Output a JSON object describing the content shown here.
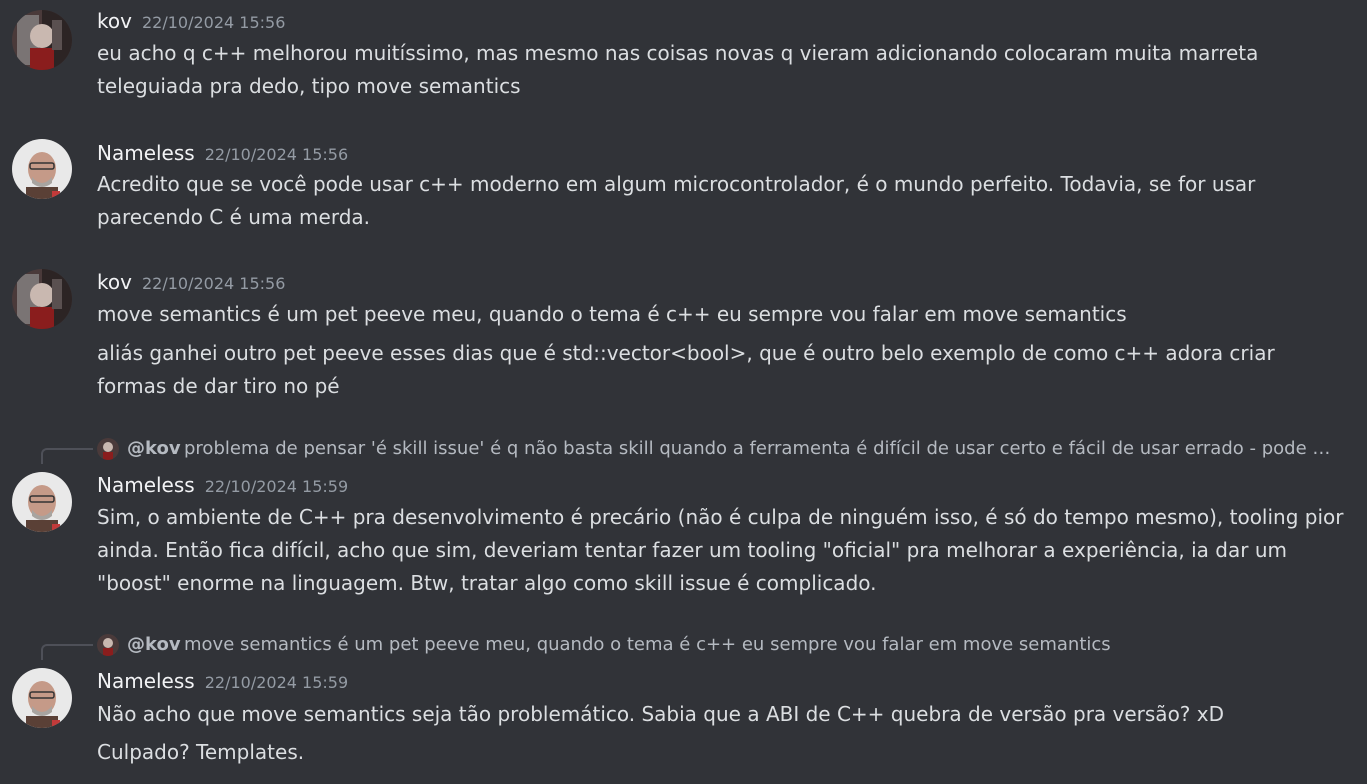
{
  "messages": [
    {
      "author": "kov",
      "timestamp": "22/10/2024 15:56",
      "lines": [
        "eu acho q c++ melhorou muitíssimo, mas mesmo nas coisas novas q vieram adicionando colocaram muita marreta",
        "teleguiada pra dedo, tipo move semantics"
      ]
    },
    {
      "author": "Nameless",
      "timestamp": "22/10/2024 15:56",
      "lines": [
        "Acredito que se você pode usar c++ moderno em algum microcontrolador, é o mundo perfeito. Todavia, se for usar",
        "parecendo C é uma merda."
      ]
    },
    {
      "author": "kov",
      "timestamp": "22/10/2024 15:56",
      "lines": [
        "move semantics é um pet peeve meu, quando o tema é c++ eu sempre vou falar em move semantics",
        "aliás ganhei outro pet peeve esses dias que é std::vector<bool>, que é outro belo exemplo de como c++ adora criar",
        "formas de dar tiro no pé"
      ]
    },
    {
      "reply": {
        "mention": "@kov",
        "text": "problema de pensar 'é skill issue' é q não basta skill quando a ferramenta é difícil de usar certo e fácil de usar errado - pode ser u..."
      },
      "author": "Nameless",
      "timestamp": "22/10/2024 15:59",
      "lines": [
        "Sim, o ambiente de C++ pra desenvolvimento é precário (não é culpa de ninguém isso, é só do tempo mesmo), tooling pior",
        "ainda. Então fica difícil, acho que sim, deveriam tentar fazer um tooling \"oficial\" pra melhorar a experiência, ia dar um",
        "\"boost\" enorme na linguagem. Btw, tratar algo como skill issue é complicado."
      ]
    },
    {
      "reply": {
        "mention": "@kov",
        "text": "move semantics é um pet peeve meu, quando o tema é c++ eu sempre vou falar em move semantics"
      },
      "author": "Nameless",
      "timestamp": "22/10/2024 15:59",
      "lines": [
        "Não acho que move semantics seja tão problemático. Sabia que a ABI de C++ quebra de versão pra versão? xD",
        "Culpado? Templates."
      ]
    }
  ]
}
